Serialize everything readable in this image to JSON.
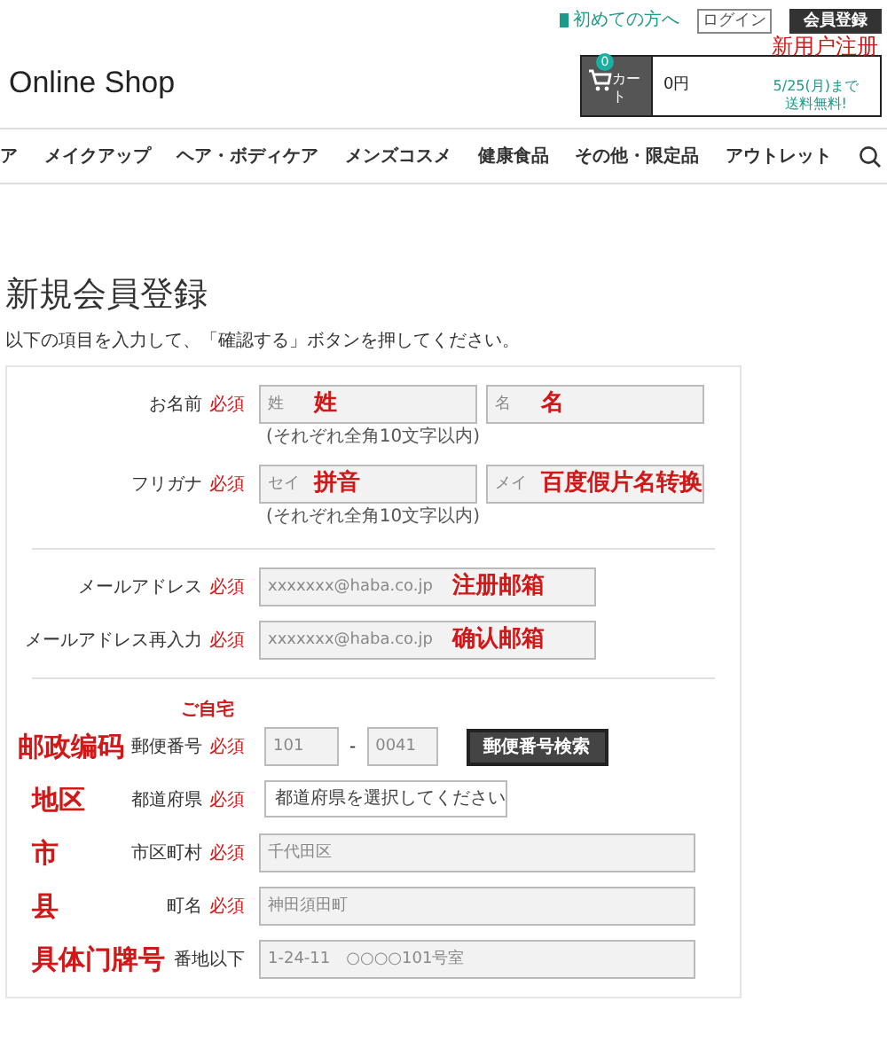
{
  "header": {
    "first_time_link": "初めての方へ",
    "login_button": "ログイン",
    "register_button": "会員登録",
    "register_annotation": "新用户注册",
    "logo": "Online Shop",
    "cart": {
      "count": "0",
      "label": "カート",
      "amount": "0円",
      "promo_lines": [
        "5/25(月)まで",
        "送料無料!"
      ]
    }
  },
  "nav": {
    "items": [
      "ア",
      "メイクアップ",
      "ヘア・ボディケア",
      "メンズコスメ",
      "健康食品",
      "その他・限定品",
      "アウトレット"
    ]
  },
  "page_title": "新規会員登録",
  "instructions": "以下の項目を入力して、「確認する」ボタンを押してください。",
  "sections": [
    {
      "rows": [
        {
          "kind": "pair",
          "label": "お名前",
          "badge": "必須",
          "fields": [
            {
              "placeholder": "姓",
              "annotation": "姓"
            },
            {
              "placeholder": "名",
              "annotation": "名"
            }
          ],
          "note": "(それぞれ全角10文字以内)"
        },
        {
          "kind": "pair",
          "label": "フリガナ",
          "badge": "必須",
          "fields": [
            {
              "placeholder": "セイ",
              "annotation": "拼音"
            },
            {
              "placeholder": "メイ",
              "annotation": "百度假片名转换"
            }
          ],
          "note": "(それぞれ全角10文字以内)"
        }
      ]
    },
    {
      "rows": [
        {
          "kind": "email",
          "label": "メールアドレス",
          "badge": "必須",
          "fields": [
            {
              "placeholder": "xxxxxxx@haba.co.jp",
              "annotation": "注册邮箱"
            }
          ]
        },
        {
          "kind": "email",
          "label": "メールアドレス再入力",
          "badge": "必須",
          "fields": [
            {
              "placeholder": "xxxxxxx@haba.co.jp",
              "annotation": "确认邮箱"
            }
          ]
        }
      ]
    },
    {
      "heading": "ご自宅",
      "rows": [
        {
          "kind": "postal",
          "side_annotation": "邮政编码",
          "label": "郵便番号",
          "badge": "必須",
          "fields": [
            {
              "placeholder": "101"
            },
            {
              "placeholder": "0041"
            }
          ],
          "separator": "-",
          "button": "郵便番号検索"
        },
        {
          "kind": "select",
          "side_annotation": "地区",
          "label": "都道府県",
          "badge": "必須",
          "value": "都道府県を選択してください"
        },
        {
          "kind": "address",
          "side_annotation": "市",
          "label": "市区町村",
          "badge": "必須",
          "fields": [
            {
              "placeholder": "千代田区"
            }
          ]
        },
        {
          "kind": "address",
          "side_annotation": "县",
          "label": "町名",
          "badge": "必須",
          "fields": [
            {
              "placeholder": "神田須田町"
            }
          ]
        },
        {
          "kind": "address",
          "side_annotation": "具体门牌号",
          "label": "番地以下",
          "fields": [
            {
              "placeholder": "1-24-11　○○○○101号室"
            }
          ]
        }
      ]
    }
  ]
}
